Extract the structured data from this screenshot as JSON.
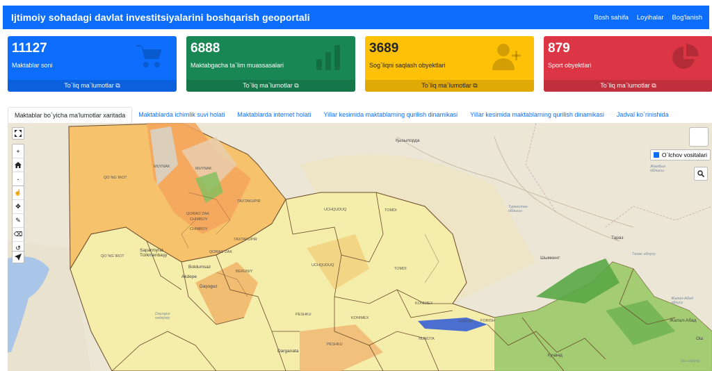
{
  "navbar": {
    "title": "Ijtimoiy sohadagi davlat investitsiyalarini boshqarish geoportali",
    "links": [
      "Bosh sahifa",
      "Loyihalar",
      "Bog'lanish"
    ]
  },
  "cards": [
    {
      "value": "11127",
      "label": "Maktablar soni",
      "footer": "To`liq ma`lumotlar",
      "color": "#0d6efd",
      "icon": "cart-icon"
    },
    {
      "value": "6888",
      "label": "Maktabgacha ta`lim muassasalari",
      "footer": "To`liq ma`lumotlar",
      "color": "#198754",
      "icon": "bar-chart-icon"
    },
    {
      "value": "3689",
      "label": "Sog`liqni saqlash obyektlari",
      "footer": "To`liq ma`lumotlar",
      "color": "#ffc107",
      "icon": "user-plus-icon"
    },
    {
      "value": "879",
      "label": "Sport obyektlari",
      "footer": "To`liq ma`lumotlar",
      "color": "#dc3545",
      "icon": "pie-chart-icon"
    }
  ],
  "tabs": [
    "Maktablar bo`yicha ma'lumotlar xaritada",
    "Maktablarda ichimlik suvi holati",
    "Maktablarda internet holati",
    "Yillar kesimida maktablarning qurilish dinamikasi",
    "Yillar kesimida maktablarning qurilish dinamikasi",
    "Jadval ko`rinishida"
  ],
  "map": {
    "measure_label": "O`lchov vositalari",
    "zoom_in": "+",
    "zoom_out": "-",
    "labels": {
      "kyzylorda": "Қызылорда",
      "turkestan": "Туркестан облысы",
      "zhambyl": "Жамбыл облысы",
      "taraz": "Тараз",
      "talas": "Талас облусу",
      "shymkent": "Шымкент",
      "jalalabad": "Жалал-Абад облусу",
      "jalalabad_city": "Жалал-Абад",
      "osh_oblast": "Ош облусу",
      "osh": "Ош",
      "xujand": "Хуҷанд",
      "sapa": "Saparmyrat Türkmenbaşy",
      "boldumsaz": "Boldumsaz",
      "akdepe": "Akdepe",
      "dasoguz": "Daşoguz",
      "dasoguz_wel": "Daşoguz welaýaty",
      "darganata": "Darganata",
      "tomdi": "TOMDI",
      "uchquduq": "UCHQUDUQ",
      "qoraozak": "QORAO`ZAK",
      "muynak": "MUYNAK",
      "qonirot": "QO`NG`IROT",
      "chimboy": "CHIMBOY",
      "taxtakupir": "TAXTAKUPIR",
      "beruniy": "BERUNIY",
      "peshku": "PESHKU",
      "konimex": "KONIMEX",
      "nurota": "NUROTA",
      "forish": "FORISH"
    }
  }
}
